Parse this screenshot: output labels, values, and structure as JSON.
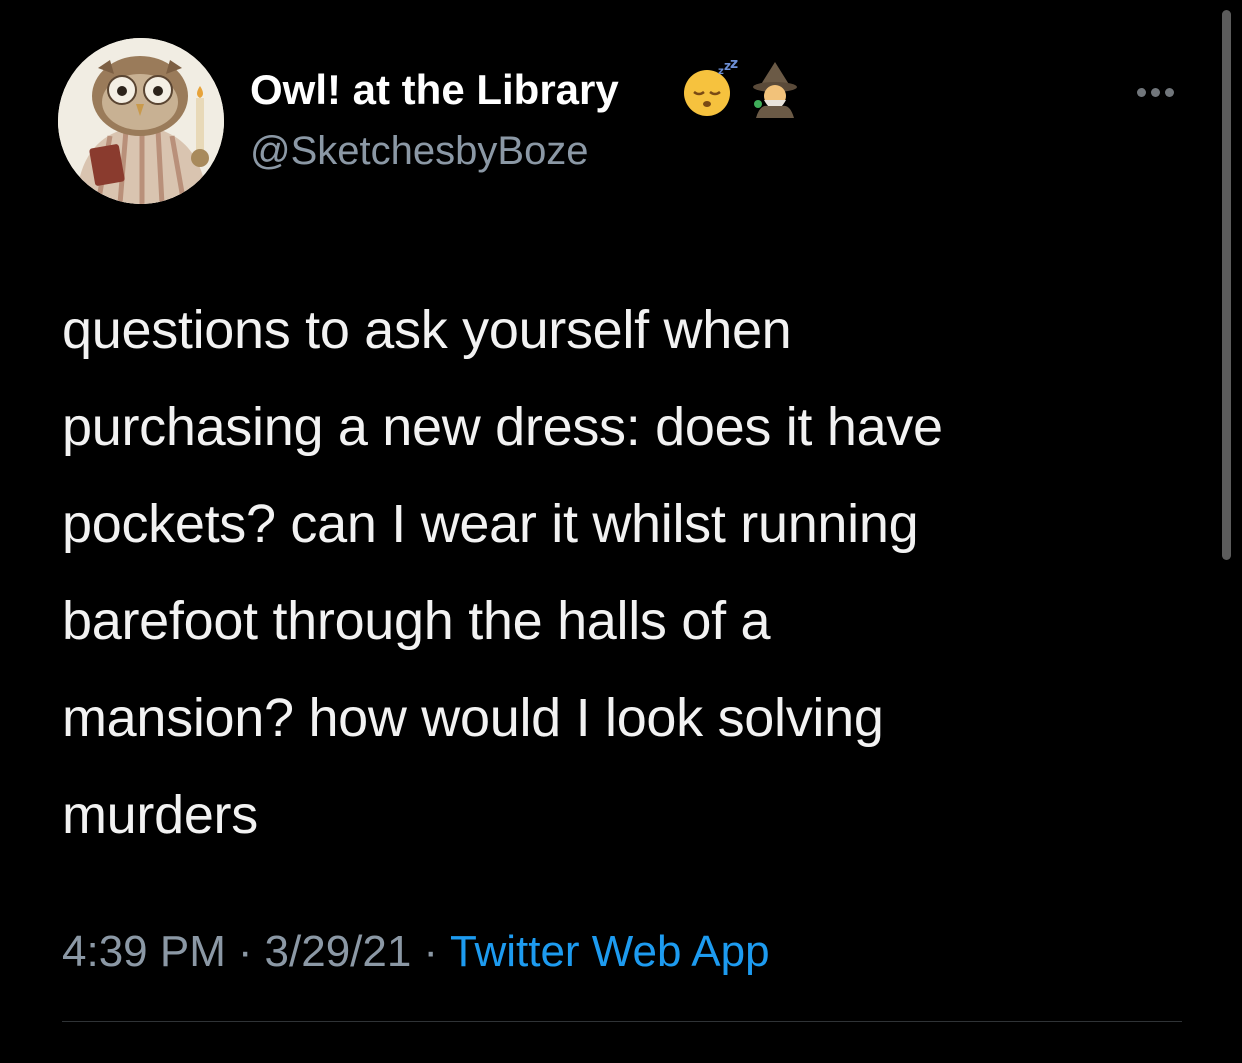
{
  "author": {
    "name": "Owl! at the Library",
    "handle": "@SketchesbyBoze",
    "emojis": [
      "sleeping-face-icon",
      "mage-icon"
    ]
  },
  "tweet": {
    "lines": [
      "questions to ask yourself when",
      "purchasing a new dress: does it have",
      "pockets? can I wear it whilst running",
      "barefoot through the halls of a",
      "mansion? how would I look solving",
      "murders"
    ]
  },
  "meta": {
    "time": "4:39 PM",
    "date": "3/29/21",
    "separator": "·",
    "source": "Twitter Web App"
  },
  "colors": {
    "background": "#000000",
    "name": "#ffffff",
    "secondary": "#8b98a5",
    "link": "#1d9bf0"
  }
}
